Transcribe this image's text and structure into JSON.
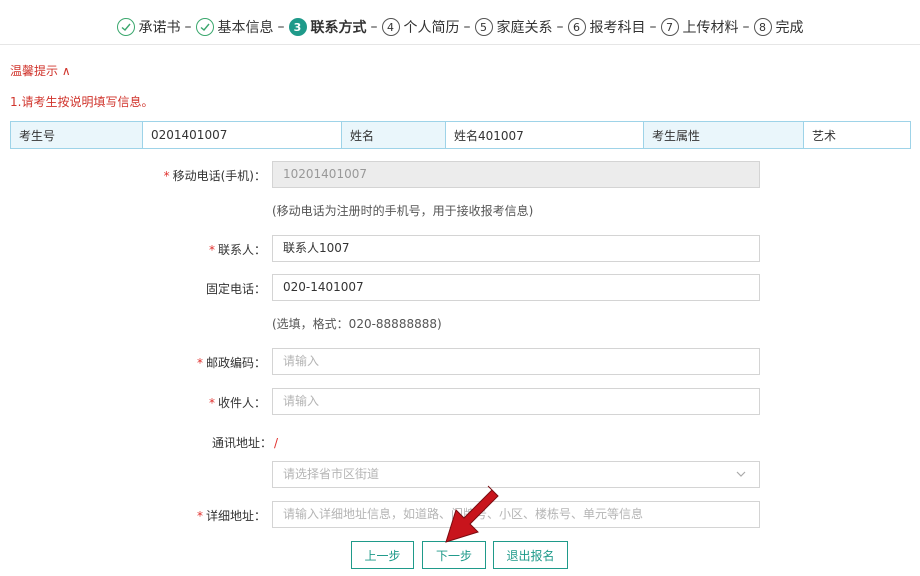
{
  "steps": [
    {
      "num": "1",
      "label": "承诺书",
      "state": "done"
    },
    {
      "num": "2",
      "label": "基本信息",
      "state": "done"
    },
    {
      "num": "3",
      "label": "联系方式",
      "state": "active"
    },
    {
      "num": "4",
      "label": "个人简历",
      "state": "todo"
    },
    {
      "num": "5",
      "label": "家庭关系",
      "state": "todo"
    },
    {
      "num": "6",
      "label": "报考科目",
      "state": "todo"
    },
    {
      "num": "7",
      "label": "上传材料",
      "state": "todo"
    },
    {
      "num": "8",
      "label": "完成",
      "state": "todo"
    }
  ],
  "step_separator": "–",
  "tips": {
    "title": "温馨提示 ∧",
    "line1": "1.请考生按说明填写信息。"
  },
  "info": {
    "exam_no_label": "考生号",
    "exam_no_value": "0201401007",
    "name_label": "姓名",
    "name_value": "姓名401007",
    "attr_label": "考生属性",
    "attr_value": "艺术"
  },
  "form": {
    "mobile": {
      "label": "移动电话(手机)：",
      "value": "10201401007",
      "required": "*"
    },
    "mobile_hint": "(移动电话为注册时的手机号，用于接收报考信息)",
    "contact": {
      "label": "联系人：",
      "value": "联系人1007",
      "required": "*"
    },
    "phone": {
      "label": "固定电话：",
      "value": "020-1401007"
    },
    "phone_hint": "(选填，格式：020-88888888)",
    "zip": {
      "label": "邮政编码：",
      "placeholder": "请输入",
      "required": "*"
    },
    "receiver": {
      "label": "收件人：",
      "placeholder": "请输入",
      "required": "*"
    },
    "address": {
      "label": "通讯地址：",
      "slash": "/"
    },
    "region_select": {
      "placeholder": "请选择省市区街道"
    },
    "detail": {
      "label": "详细地址：",
      "placeholder": "请输入详细地址信息，如道路、门牌号、小区、楼栋号、单元等信息",
      "required": "*"
    }
  },
  "buttons": {
    "prev": "上一步",
    "next": "下一步",
    "quit": "退出报名"
  },
  "colors": {
    "accent": "#1f9a8a",
    "done_check": "#3aa76d",
    "required": "#e0302d",
    "tip": "#d0342c",
    "table_border": "#9ed3e8",
    "table_label_bg": "#eaf6fb",
    "arrow": "#c8141c"
  }
}
